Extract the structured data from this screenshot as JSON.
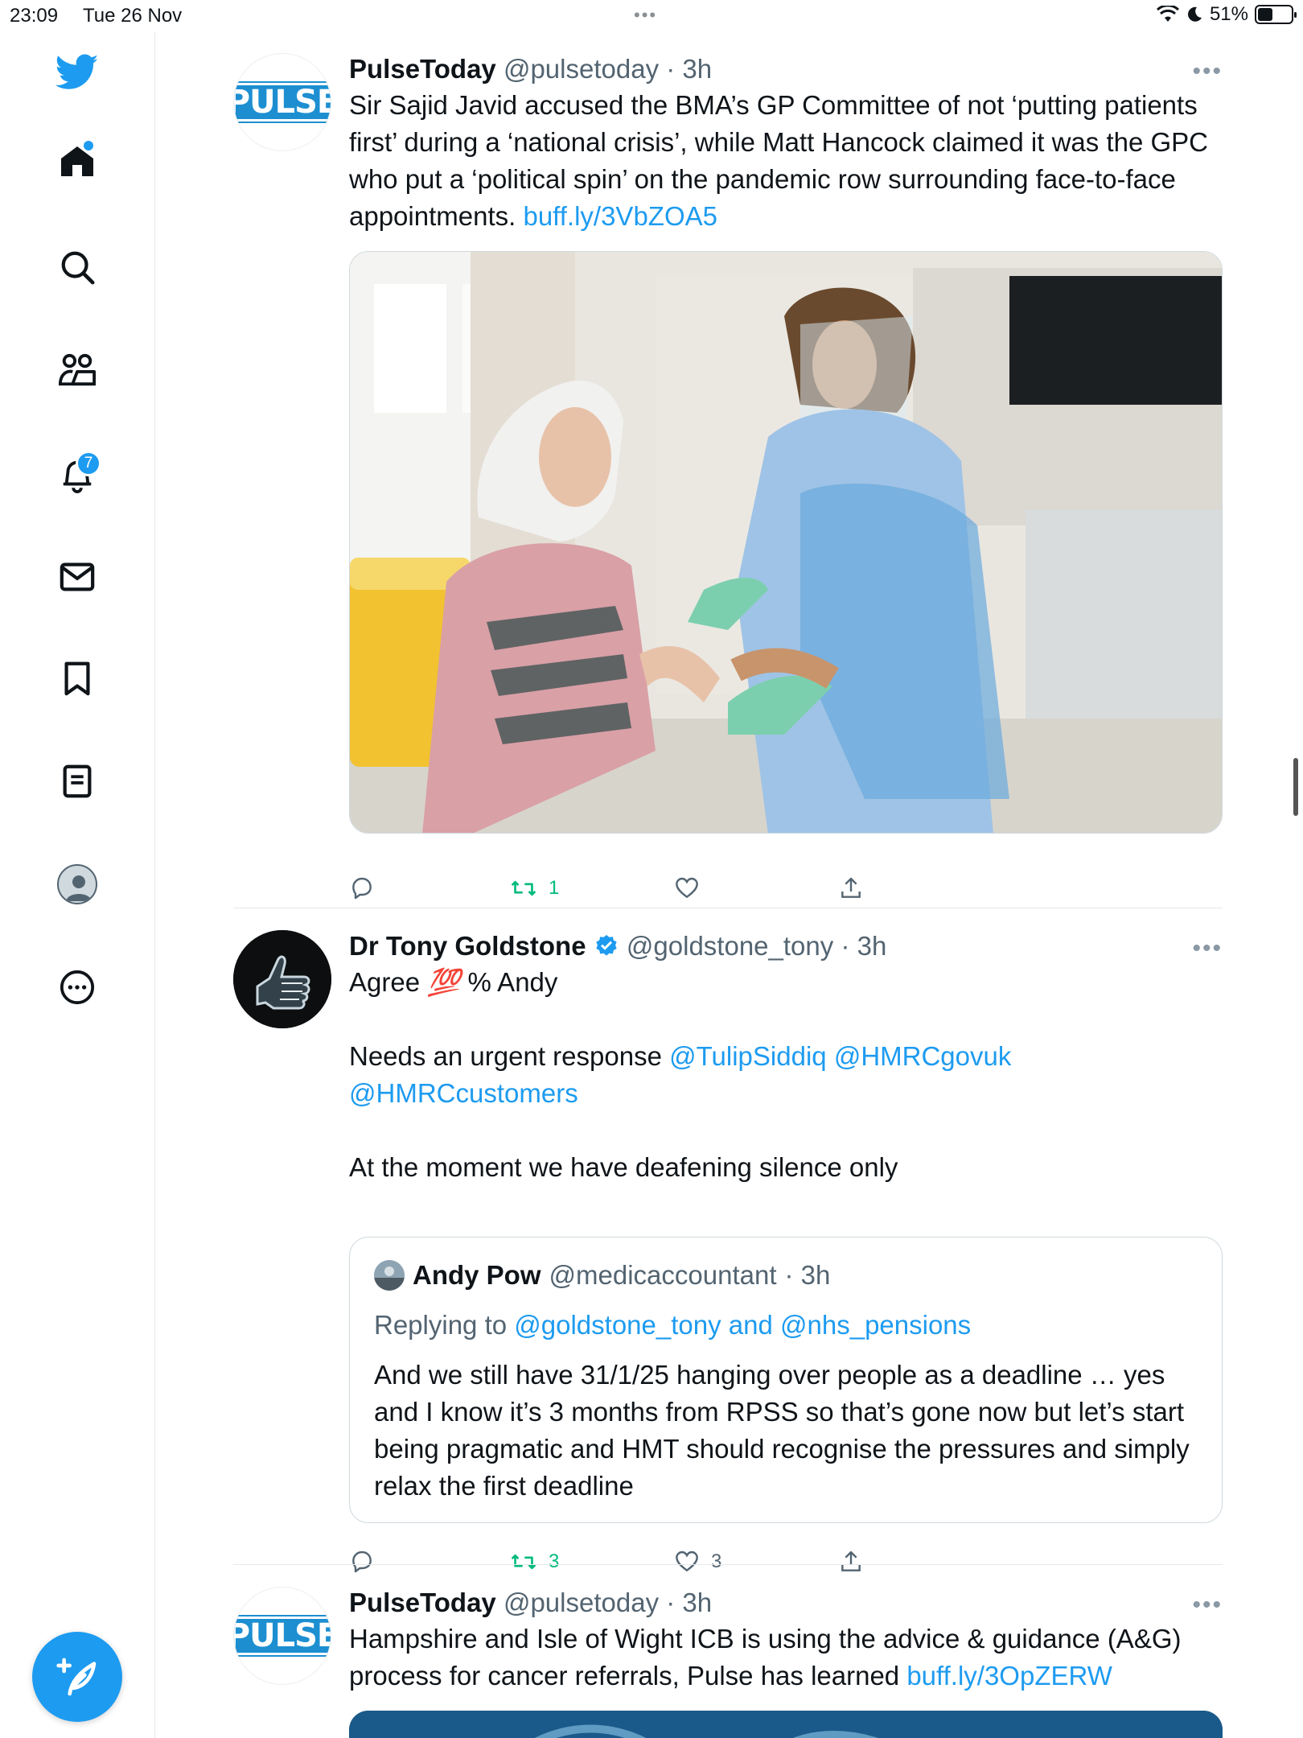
{
  "status_bar": {
    "time": "23:09",
    "date": "Tue 26 Nov",
    "battery": "51%",
    "battery_level": 0.51
  },
  "sidebar": {
    "notification_count": "7",
    "items": [
      {
        "icon": "bird-logo-icon"
      },
      {
        "icon": "home-icon"
      },
      {
        "icon": "search-icon"
      },
      {
        "icon": "communities-icon"
      },
      {
        "icon": "bell-icon"
      },
      {
        "icon": "mail-icon"
      },
      {
        "icon": "bookmark-icon"
      },
      {
        "icon": "lists-icon"
      },
      {
        "icon": "profile-icon"
      },
      {
        "icon": "more-circle-icon"
      }
    ]
  },
  "logo_text": "PULSE",
  "tweets": [
    {
      "name": "PulseToday",
      "handle": "@pulsetoday",
      "time": "· 3h",
      "text": "Sir Sajid Javid accused the BMA’s GP Committee of not ‘putting patients first’ during a ‘national crisis’, while Matt Hancock claimed it was the GPC who put a ‘political spin’ on the pandemic row surrounding face-to-face appointments. ",
      "link": "buff.ly/3VbZOA5",
      "retweets": "1",
      "likes": ""
    },
    {
      "name": "Dr Tony Goldstone",
      "handle": "@goldstone_tony",
      "time": "· 3h",
      "line1_pre": "Agree ",
      "emoji": "💯",
      "line1_post": " % Andy",
      "line2": "Needs an urgent response ",
      "mention1": "@TulipSiddiq",
      "mention2": "@HMRCgovuk",
      "mention3": "@HMRCcustomers",
      "line3": "At the moment we have deafening silence only",
      "retweets": "3",
      "likes": "3",
      "quote": {
        "name": "Andy Pow",
        "handle": "@medicaccountant",
        "time": "· 3h",
        "replying_label": "Replying to ",
        "replying_to": "@goldstone_tony and @nhs_pensions",
        "text": "And we still have 31/1/25 hanging over people as a deadline … yes and I know it’s 3 months from RPSS so that’s gone now but let’s start being pragmatic and HMT should recognise the pressures and simply relax the first deadline"
      }
    },
    {
      "name": "PulseToday",
      "handle": "@pulsetoday",
      "time": "· 3h",
      "text": "Hampshire and Isle of Wight ICB is using the advice & guidance (A&G) process for cancer referrals, Pulse has learned ",
      "link": "buff.ly/3OpZERW"
    }
  ],
  "colors": {
    "accent": "#1d9bf0",
    "retweet": "#00ba7c",
    "muted": "#536471",
    "pulse_brand": "#1d8fd1"
  }
}
